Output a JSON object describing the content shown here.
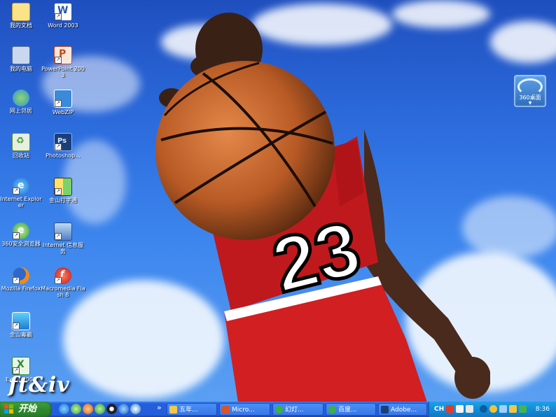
{
  "desktop": {
    "icons": [
      {
        "name": "my-documents-icon",
        "label": "我的文档"
      },
      {
        "name": "word-2003-icon",
        "label": "Word 2003"
      },
      {
        "name": "my-computer-icon",
        "label": "我的电脑"
      },
      {
        "name": "powerpoint-2003-icon",
        "label": "PowerPoint 2003"
      },
      {
        "name": "network-neighborhood-icon",
        "label": "网上邻居"
      },
      {
        "name": "webzip-icon",
        "label": "WebZIP"
      },
      {
        "name": "recycle-bin-icon",
        "label": "回收站"
      },
      {
        "name": "photoshop-icon",
        "label": "Photoshop..."
      },
      {
        "name": "internet-explorer-icon",
        "label": "Internet Explorer"
      },
      {
        "name": "kingsoft-typing-icon",
        "label": "金山打字通"
      },
      {
        "name": "360-browser-icon",
        "label": "360安全浏览器"
      },
      {
        "name": "internet-info-service-icon",
        "label": "Internet 信息服务"
      },
      {
        "name": "mozilla-firefox-icon",
        "label": "Mozilla Firefox"
      },
      {
        "name": "macromedia-flash-icon",
        "label": "Macromedia Flash 8"
      },
      {
        "name": "kingsoft-antivirus-icon",
        "label": "金山毒霸"
      },
      {
        "name": "excel-2003-icon",
        "label": "Excel 2003"
      }
    ],
    "widget_label": "360桌面",
    "brand_text": "ft&iv"
  },
  "taskbar": {
    "start_label": "开始",
    "quick_launch": [
      "ie-icon",
      "browser-icon",
      "media-icon",
      "chat-icon",
      "qq-icon",
      "k-icon",
      "search-icon"
    ],
    "expand_glyph": "»",
    "tasks": [
      {
        "name": "task-folder",
        "label": "五年...",
        "icon_color": "#f3c94a"
      },
      {
        "name": "task-powerpoint",
        "label": "Micro...",
        "icon_color": "#d9542a"
      },
      {
        "name": "task-slideshow",
        "label": "幻灯...",
        "icon_color": "#3cb043"
      },
      {
        "name": "task-baidu",
        "label": "百度...",
        "icon_color": "#3cb043"
      },
      {
        "name": "task-adobe",
        "label": "Adobe...",
        "icon_color": "#1c3f7a"
      }
    ],
    "tray": {
      "lang": "CH",
      "clock": "8:36"
    }
  },
  "colors": {
    "taskbar": "#245edb",
    "start": "#2f8a2f",
    "tray": "#148cd8"
  }
}
